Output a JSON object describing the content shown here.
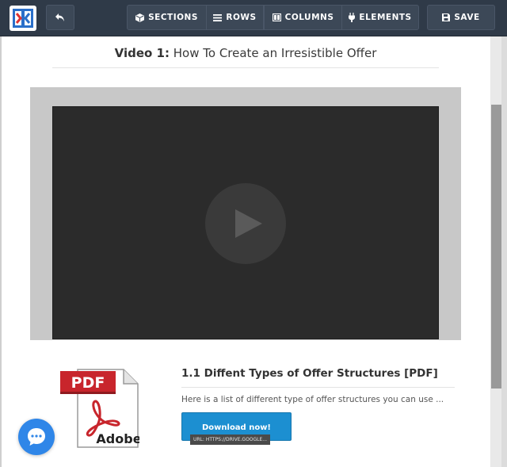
{
  "toolbar": {
    "sections_label": "SECTIONS",
    "rows_label": "ROWS",
    "columns_label": "COLUMNS",
    "elements_label": "ELEMENTS",
    "save_label": "SAVE"
  },
  "video": {
    "title_prefix": "Video 1:",
    "title_text": " How To Create an Irresistible Offer"
  },
  "pdf": {
    "icon_badge": "PDF",
    "icon_brand": "Adobe",
    "title": "1.1 Diffent Types of Offer Structures [PDF]",
    "description": "Here is a list of different type of offer structures you can use ...",
    "download_label": "Download now!",
    "url_tooltip": "URL: HTTPS://DRIVE.GOOGLE..."
  },
  "colors": {
    "toolbar_bg": "#2f3a48",
    "download_button": "#1c8fd1",
    "chat_button": "#2f86e8",
    "pdf_red": "#c8252c"
  },
  "icons": [
    "logo-icon",
    "undo-icon",
    "cube-icon",
    "rows-icon",
    "columns-icon",
    "plug-icon",
    "save-icon",
    "play-icon",
    "pdf-icon",
    "chat-icon"
  ]
}
